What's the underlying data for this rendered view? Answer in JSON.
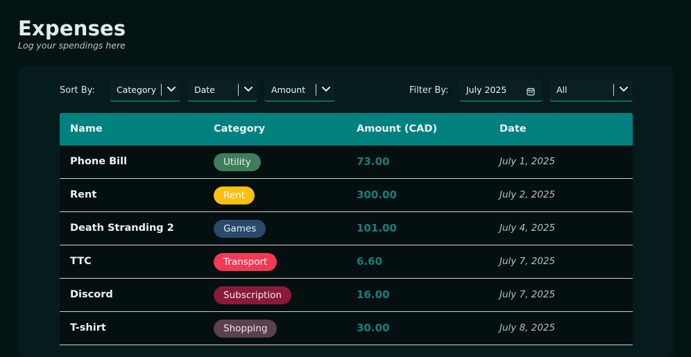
{
  "header": {
    "title": "Expenses",
    "subtitle": "Log your spendings here"
  },
  "controls": {
    "sort_label": "Sort By:",
    "sort_category": "Category",
    "sort_date": "Date",
    "sort_amount": "Amount",
    "filter_label": "Filter By:",
    "filter_month": "July 2025",
    "filter_category": "All"
  },
  "table": {
    "columns": [
      "Name",
      "Category",
      "Amount (CAD)",
      "Date"
    ],
    "rows": [
      {
        "name": "Phone Bill",
        "category": "Utility",
        "amount": "73.00",
        "date": "July 1, 2025"
      },
      {
        "name": "Rent",
        "category": "Rent",
        "amount": "300.00",
        "date": "July 2, 2025"
      },
      {
        "name": "Death Stranding 2",
        "category": "Games",
        "amount": "101.00",
        "date": "July 4, 2025"
      },
      {
        "name": "TTC",
        "category": "Transport",
        "amount": "6.60",
        "date": "July 7, 2025"
      },
      {
        "name": "Discord",
        "category": "Subscription",
        "amount": "16.00",
        "date": "July 7, 2025"
      },
      {
        "name": "T-shirt",
        "category": "Shopping",
        "amount": "30.00",
        "date": "July 8, 2025"
      }
    ]
  },
  "colors": {
    "accent": "#00807f",
    "background": "#041414",
    "panel": "#061c1c",
    "amount_text": "#13807e",
    "category_utility": "#3f7d5c",
    "category_rent": "#fbbf0e",
    "category_games": "#2a4a6b",
    "category_transport": "#f23a55",
    "category_subscription": "#8a1a3a",
    "category_shopping": "#5c4050"
  },
  "icons": {
    "dropdown": "chevron-down-icon",
    "calendar": "calendar-icon"
  }
}
